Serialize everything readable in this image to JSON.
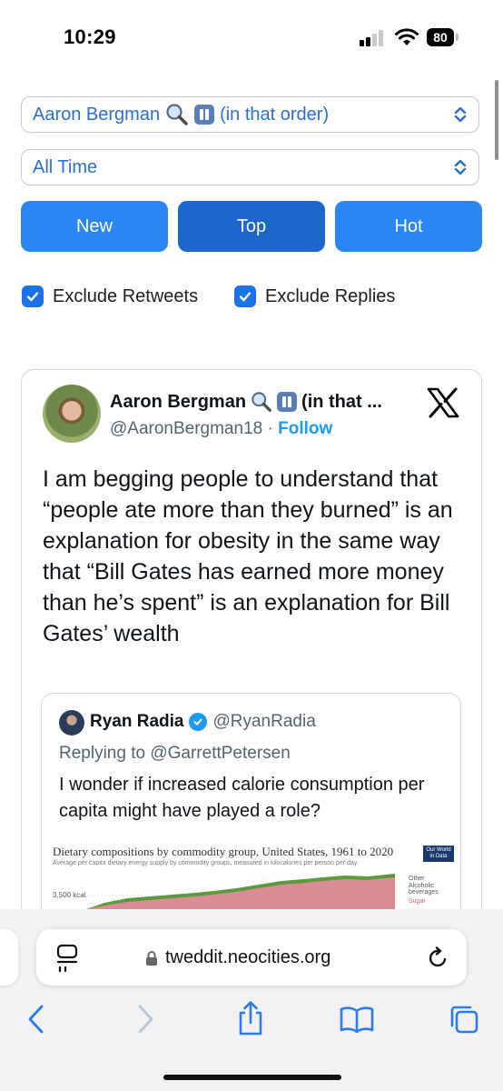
{
  "status_bar": {
    "time": "10:29",
    "battery": "80"
  },
  "filters": {
    "user_select": {
      "name": "Aaron Bergman",
      "suffix": "(in that order)"
    },
    "time_select": "All Time",
    "tabs": [
      "New",
      "Top",
      "Hot"
    ],
    "active_tab": "Top",
    "checkboxes": [
      {
        "label": "Exclude Retweets",
        "checked": true
      },
      {
        "label": "Exclude Replies",
        "checked": true
      }
    ]
  },
  "tweet": {
    "author_name": "Aaron Bergman",
    "author_name_suffix": "(in that ...",
    "handle": "@AaronBergman18",
    "separator": " · ",
    "follow": "Follow",
    "text": "I am begging people to understand that “people ate more than they burned” is an explanation for obesity in the same way that “Bill Gates has earned more money than he’s spent” is an explanation for Bill Gates’ wealth",
    "quoted": {
      "author_name": "Ryan Radia",
      "handle": "@RyanRadia",
      "replying_to": "Replying to @GarrettPetersen",
      "text": "I wonder if increased calorie consumption per capita might have played a role?",
      "chart": {
        "title": "Dietary compositions by commodity group, United States, 1961 to 2020",
        "subtitle": "Average per capita dietary energy supply by commodity groups, measured in kilocalories per person per day.",
        "badge_line1": "Our World",
        "badge_line2": "in Data",
        "tick_label": "3,500 kcal",
        "legend": [
          "Other",
          "Alcoholic",
          "beverages",
          "Sugar"
        ]
      }
    }
  },
  "browser": {
    "url": "tweddit.neocities.org"
  },
  "colors": {
    "accent": "#2a86f5",
    "active_tab": "#1c66cc",
    "link": "#1d9bf0"
  }
}
